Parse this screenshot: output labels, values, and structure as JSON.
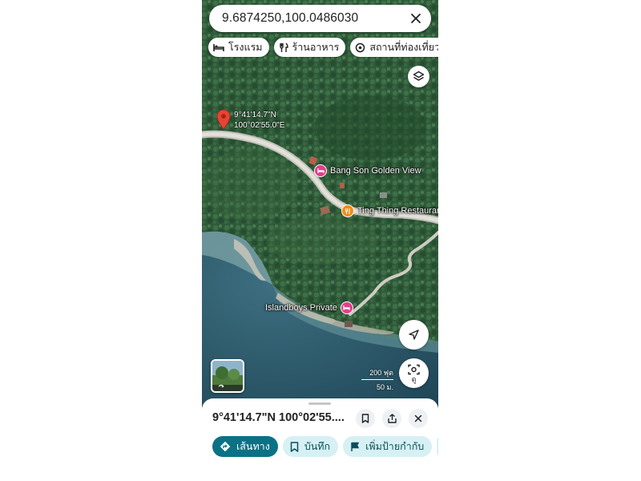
{
  "search": {
    "query": "9.6874250,100.0486030"
  },
  "chips": [
    {
      "icon": "bed-icon",
      "label": "โรงแรม"
    },
    {
      "icon": "fork-knife-icon",
      "label": "ร้านอาหาร"
    },
    {
      "icon": "camera-icon",
      "label": "สถานที่ท่องเที่ยว"
    },
    {
      "icon": "monitor-icon",
      "label": ""
    }
  ],
  "pin": {
    "lat": "9°41'14.7\"N",
    "lng": "100°02'55.0\"E"
  },
  "places": [
    {
      "name": "Bang Son Golden View",
      "type": "hotel",
      "color": "#e0408a"
    },
    {
      "name": "Ting Thing Restaurant",
      "type": "restaurant",
      "color": "#f08c1a"
    },
    {
      "name": "Islandboys Private",
      "type": "hotel",
      "color": "#e0408a"
    }
  ],
  "scale": {
    "feet": "200 ฟุต",
    "meters": "50 ม."
  },
  "lens": {
    "label": "ดู"
  },
  "sheet": {
    "title": "9°41'14.7\"N 100°02'55...."
  },
  "actions": [
    {
      "icon": "directions-icon",
      "label": "เส้นทาง",
      "style": "primary"
    },
    {
      "icon": "bookmark-icon",
      "label": "บันทึก",
      "style": "secondary"
    },
    {
      "icon": "flag-icon",
      "label": "เพิ่มป้ายกำกับ",
      "style": "secondary"
    }
  ],
  "colors": {
    "primary": "#0b7285",
    "secondary_bg": "#d6f0f4",
    "pin": "#ea4335"
  }
}
